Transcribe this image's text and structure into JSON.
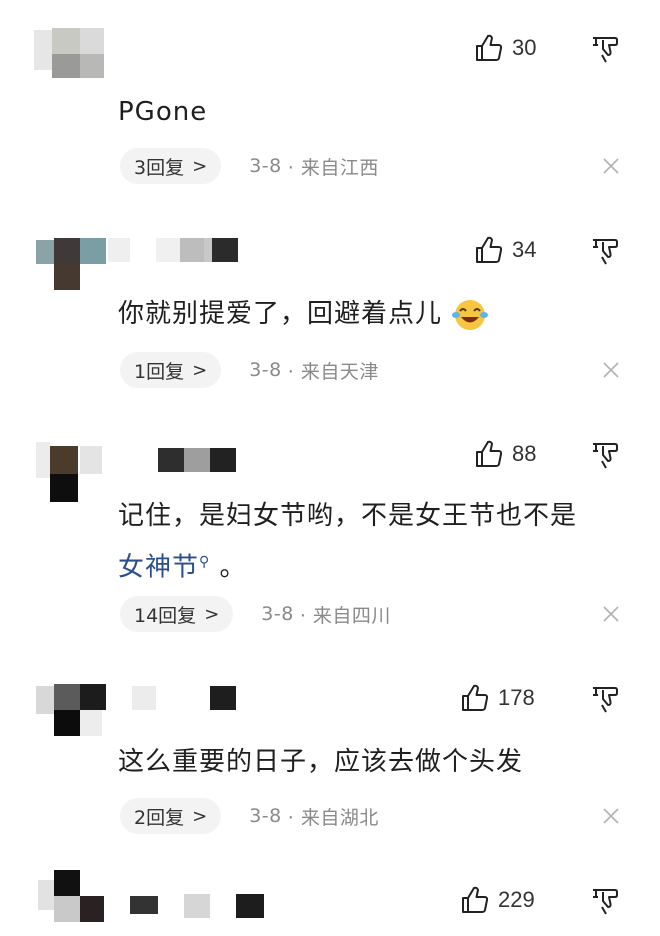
{
  "comments": [
    {
      "likes": "30",
      "text": "PGone",
      "replies": "3回复",
      "date": "3-8",
      "location": "· 来自江西"
    },
    {
      "likes": "34",
      "text": "你就别提爱了，回避着点儿",
      "emoji": "laughing-crying-emoji",
      "replies": "1回复",
      "date": "3-8",
      "location": "· 来自天津"
    },
    {
      "likes": "88",
      "text_line1": "记住，是妇女节哟，不是女王节也不是",
      "link": "女神节",
      "text_line2_tail": " 。",
      "replies": "14回复",
      "date": "3-8",
      "location": "· 来自四川"
    },
    {
      "likes": "178",
      "text": "这么重要的日子，应该去做个头发",
      "replies": "2回复",
      "date": "3-8",
      "location": "· 来自湖北"
    },
    {
      "likes": "229"
    }
  ],
  "icons": {
    "like": "thumbs-up-icon",
    "dislike": "thumbs-down-icon",
    "close": "close-icon",
    "chevron": "chevron-right-icon",
    "link_search": "search-icon"
  },
  "chevron_glyph": ">"
}
